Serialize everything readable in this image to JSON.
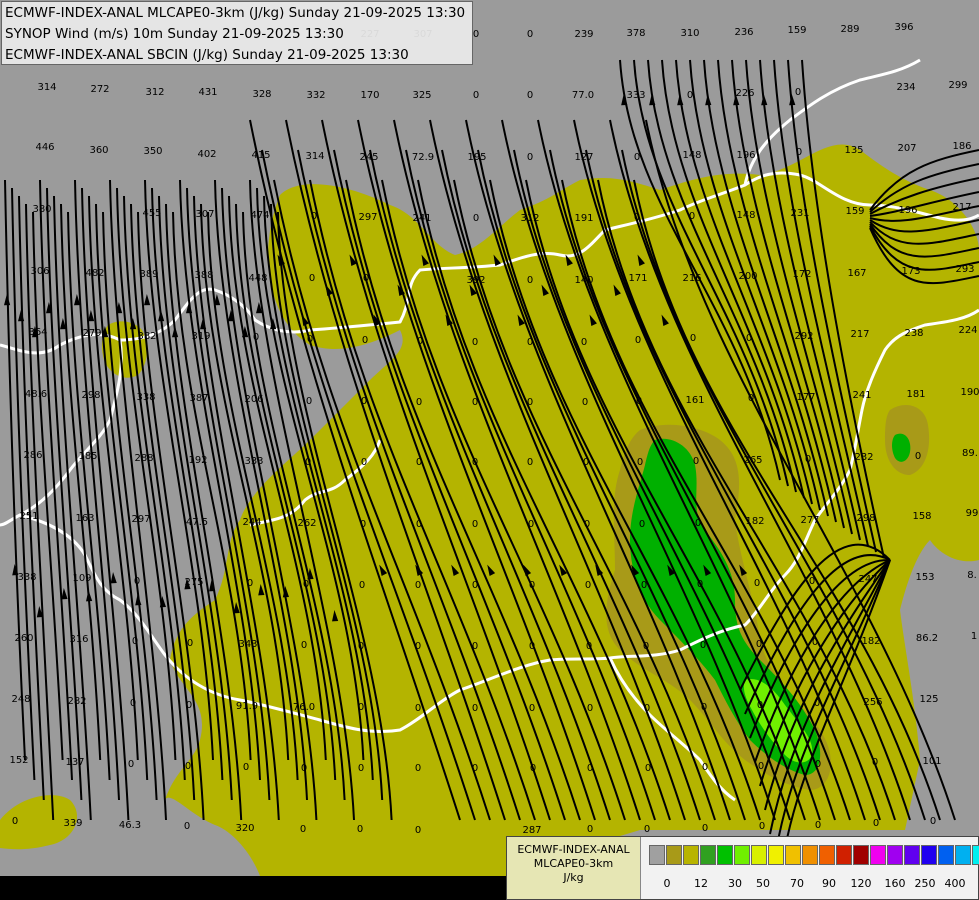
{
  "titles": [
    "ECMWF-INDEX-ANAL MLCAPE0-3km (J/kg) Sunday 21-09-2025 13:30",
    "SYNOP Wind (m/s) 10m Sunday 21-09-2025 13:30",
    "ECMWF-INDEX-ANAL SBCIN (J/kg) Sunday 21-09-2025 13:30"
  ],
  "legend": {
    "line1": "ECMWF-INDEX-ANAL",
    "line2": "MLCAPE0-3km",
    "units": "J/kg",
    "tick_labels": [
      "0",
      "12",
      "30",
      "50",
      "70",
      "90",
      "120",
      "160",
      "250",
      "400"
    ],
    "colors": [
      "#a0a0a0",
      "#a89a18",
      "#b8b400",
      "#30a020",
      "#00c000",
      "#70f000",
      "#d8f000",
      "#f0f000",
      "#f0c000",
      "#f09000",
      "#f06000",
      "#d02000",
      "#a00000",
      "#f000f0",
      "#a000f0",
      "#6000f0",
      "#2000f0",
      "#0060f0",
      "#00b0f0",
      "#00f0f0",
      "#b0f0f0",
      "#ffffff"
    ]
  },
  "map_colors": {
    "background": "#9b9b9b",
    "low_cape": "#b4b400",
    "mid_cape": "#a89a18",
    "high_cape": "#00b000",
    "very_high_cape": "#70f000",
    "borders": "#ffffff",
    "wind_lines": "#000000"
  },
  "numbers": [
    [
      "314",
      47,
      90
    ],
    [
      "272",
      100,
      92
    ],
    [
      "312",
      155,
      95
    ],
    [
      "431",
      208,
      95
    ],
    [
      "328",
      262,
      97
    ],
    [
      "332",
      316,
      98
    ],
    [
      "170",
      370,
      98
    ],
    [
      "325",
      422,
      98
    ],
    [
      "0",
      476,
      98
    ],
    [
      "0",
      530,
      98
    ],
    [
      "77.0",
      583,
      98
    ],
    [
      "333",
      636,
      98
    ],
    [
      "0",
      690,
      98
    ],
    [
      "226",
      745,
      96
    ],
    [
      "0",
      798,
      95
    ],
    [
      "234",
      906,
      90
    ],
    [
      "299",
      958,
      88
    ],
    [
      "227",
      370,
      37
    ],
    [
      "307",
      423,
      37
    ],
    [
      "0",
      476,
      37
    ],
    [
      "0",
      530,
      37
    ],
    [
      "239",
      584,
      37
    ],
    [
      "378",
      636,
      36
    ],
    [
      "310",
      690,
      36
    ],
    [
      "236",
      744,
      35
    ],
    [
      "159",
      797,
      33
    ],
    [
      "289",
      850,
      32
    ],
    [
      "396",
      904,
      30
    ],
    [
      "446",
      45,
      150
    ],
    [
      "360",
      99,
      153
    ],
    [
      "350",
      153,
      154
    ],
    [
      "402",
      207,
      157
    ],
    [
      "415",
      261,
      158
    ],
    [
      "314",
      315,
      159
    ],
    [
      "245",
      369,
      160
    ],
    [
      "72.9",
      423,
      160
    ],
    [
      "195",
      477,
      160
    ],
    [
      "0",
      530,
      160
    ],
    [
      "127",
      584,
      160
    ],
    [
      "0",
      637,
      160
    ],
    [
      "148",
      692,
      158
    ],
    [
      "196",
      746,
      158
    ],
    [
      "0",
      799,
      155
    ],
    [
      "135",
      854,
      153
    ],
    [
      "207",
      907,
      151
    ],
    [
      "186",
      962,
      149
    ],
    [
      "380",
      42,
      212
    ],
    [
      "455",
      152,
      216
    ],
    [
      "307",
      205,
      217
    ],
    [
      "474",
      260,
      218
    ],
    [
      "0",
      314,
      219
    ],
    [
      "297",
      368,
      220
    ],
    [
      "241",
      422,
      221
    ],
    [
      "0",
      476,
      221
    ],
    [
      "312",
      530,
      221
    ],
    [
      "191",
      584,
      221
    ],
    [
      "0",
      637,
      220
    ],
    [
      "0",
      692,
      219
    ],
    [
      "148",
      746,
      218
    ],
    [
      "231",
      800,
      216
    ],
    [
      "159",
      855,
      214
    ],
    [
      "196",
      908,
      213
    ],
    [
      "217",
      962,
      210
    ],
    [
      "306",
      40,
      274
    ],
    [
      "482",
      95,
      276
    ],
    [
      "389",
      149,
      277
    ],
    [
      "388",
      204,
      278
    ],
    [
      "448",
      258,
      281
    ],
    [
      "0",
      312,
      281
    ],
    [
      "0",
      366,
      281
    ],
    [
      "392",
      476,
      283
    ],
    [
      "0",
      530,
      283
    ],
    [
      "140",
      584,
      283
    ],
    [
      "171",
      638,
      281
    ],
    [
      "216",
      692,
      281
    ],
    [
      "200",
      748,
      279
    ],
    [
      "172",
      802,
      277
    ],
    [
      "167",
      857,
      276
    ],
    [
      "173",
      911,
      274
    ],
    [
      "293",
      965,
      272
    ],
    [
      "364",
      38,
      335
    ],
    [
      "279",
      92,
      336
    ],
    [
      "382",
      147,
      339
    ],
    [
      "319",
      201,
      339
    ],
    [
      "0",
      256,
      340
    ],
    [
      "0",
      310,
      342
    ],
    [
      "0",
      365,
      343
    ],
    [
      "0",
      420,
      344
    ],
    [
      "0",
      475,
      345
    ],
    [
      "0",
      530,
      345
    ],
    [
      "0",
      584,
      345
    ],
    [
      "0",
      638,
      343
    ],
    [
      "0",
      693,
      341
    ],
    [
      "0",
      749,
      341
    ],
    [
      "292",
      804,
      339
    ],
    [
      "217",
      860,
      337
    ],
    [
      "238",
      914,
      336
    ],
    [
      "224",
      968,
      333
    ],
    [
      "48.6",
      36,
      397
    ],
    [
      "298",
      91,
      398
    ],
    [
      "338",
      146,
      400
    ],
    [
      "387",
      199,
      401
    ],
    [
      "206",
      254,
      402
    ],
    [
      "0",
      309,
      404
    ],
    [
      "0",
      364,
      404
    ],
    [
      "0",
      419,
      405
    ],
    [
      "0",
      475,
      405
    ],
    [
      "0",
      530,
      405
    ],
    [
      "0",
      585,
      405
    ],
    [
      "0",
      639,
      404
    ],
    [
      "161",
      695,
      403
    ],
    [
      "0",
      751,
      401
    ],
    [
      "177",
      806,
      400
    ],
    [
      "241",
      862,
      398
    ],
    [
      "181",
      916,
      397
    ],
    [
      "190",
      970,
      395
    ],
    [
      "286",
      33,
      458
    ],
    [
      "185",
      88,
      459
    ],
    [
      "288",
      144,
      461
    ],
    [
      "192",
      198,
      463
    ],
    [
      "333",
      254,
      464
    ],
    [
      "0",
      308,
      465
    ],
    [
      "0",
      364,
      465
    ],
    [
      "0",
      419,
      465
    ],
    [
      "0",
      475,
      465
    ],
    [
      "0",
      530,
      465
    ],
    [
      "0",
      586,
      465
    ],
    [
      "0",
      640,
      465
    ],
    [
      "0",
      696,
      464
    ],
    [
      "265",
      753,
      463
    ],
    [
      "0",
      808,
      462
    ],
    [
      "232",
      864,
      460
    ],
    [
      "0",
      918,
      459
    ],
    [
      "89.",
      970,
      456
    ],
    [
      "251",
      29,
      519
    ],
    [
      "163",
      85,
      521
    ],
    [
      "297",
      141,
      522
    ],
    [
      "47.5",
      197,
      525
    ],
    [
      "244",
      252,
      525
    ],
    [
      "262",
      307,
      526
    ],
    [
      "0",
      363,
      527
    ],
    [
      "0",
      419,
      527
    ],
    [
      "0",
      475,
      527
    ],
    [
      "0",
      531,
      527
    ],
    [
      "0",
      587,
      527
    ],
    [
      "0",
      642,
      527
    ],
    [
      "0",
      698,
      526
    ],
    [
      "182",
      755,
      524
    ],
    [
      "277",
      810,
      523
    ],
    [
      "298",
      866,
      521
    ],
    [
      "158",
      922,
      519
    ],
    [
      "99",
      972,
      516
    ],
    [
      "338",
      27,
      580
    ],
    [
      "109",
      82,
      581
    ],
    [
      "0",
      137,
      584
    ],
    [
      "275",
      194,
      585
    ],
    [
      "0",
      250,
      586
    ],
    [
      "0",
      306,
      587
    ],
    [
      "0",
      362,
      588
    ],
    [
      "0",
      418,
      588
    ],
    [
      "0",
      475,
      588
    ],
    [
      "0",
      532,
      588
    ],
    [
      "0",
      588,
      588
    ],
    [
      "0",
      644,
      588
    ],
    [
      "0",
      700,
      587
    ],
    [
      "0",
      757,
      586
    ],
    [
      "0",
      812,
      584
    ],
    [
      "247",
      868,
      582
    ],
    [
      "153",
      925,
      580
    ],
    [
      "8.",
      972,
      578
    ],
    [
      "260",
      24,
      641
    ],
    [
      "316",
      79,
      642
    ],
    [
      "0",
      135,
      644
    ],
    [
      "0",
      190,
      646
    ],
    [
      "343",
      248,
      647
    ],
    [
      "0",
      304,
      648
    ],
    [
      "0",
      361,
      649
    ],
    [
      "0",
      418,
      649
    ],
    [
      "0",
      475,
      649
    ],
    [
      "0",
      532,
      649
    ],
    [
      "0",
      589,
      649
    ],
    [
      "0",
      646,
      649
    ],
    [
      "0",
      703,
      648
    ],
    [
      "0",
      759,
      647
    ],
    [
      "0",
      815,
      645
    ],
    [
      "182",
      871,
      644
    ],
    [
      "86.2",
      927,
      641
    ],
    [
      "1",
      974,
      639
    ],
    [
      "248",
      21,
      702
    ],
    [
      "282",
      77,
      704
    ],
    [
      "0",
      133,
      706
    ],
    [
      "0",
      189,
      708
    ],
    [
      "91.9",
      247,
      709
    ],
    [
      "76.0",
      304,
      710
    ],
    [
      "0",
      361,
      710
    ],
    [
      "0",
      418,
      711
    ],
    [
      "0",
      475,
      711
    ],
    [
      "0",
      532,
      711
    ],
    [
      "0",
      590,
      711
    ],
    [
      "0",
      647,
      711
    ],
    [
      "0",
      704,
      710
    ],
    [
      "0",
      760,
      708
    ],
    [
      "0",
      817,
      706
    ],
    [
      "256",
      873,
      705
    ],
    [
      "125",
      929,
      702
    ],
    [
      "152",
      19,
      763
    ],
    [
      "137",
      75,
      765
    ],
    [
      "0",
      131,
      767
    ],
    [
      "0",
      188,
      769
    ],
    [
      "0",
      246,
      770
    ],
    [
      "0",
      304,
      771
    ],
    [
      "0",
      361,
      771
    ],
    [
      "0",
      418,
      771
    ],
    [
      "0",
      475,
      771
    ],
    [
      "0",
      533,
      771
    ],
    [
      "0",
      590,
      771
    ],
    [
      "0",
      648,
      771
    ],
    [
      "0",
      705,
      770
    ],
    [
      "0",
      761,
      769
    ],
    [
      "0",
      818,
      767
    ],
    [
      "0",
      875,
      765
    ],
    [
      "101",
      932,
      764
    ],
    [
      "0",
      15,
      824
    ],
    [
      "339",
      73,
      826
    ],
    [
      "46.3",
      130,
      828
    ],
    [
      "0",
      187,
      829
    ],
    [
      "320",
      245,
      831
    ],
    [
      "0",
      303,
      832
    ],
    [
      "0",
      360,
      832
    ],
    [
      "0",
      418,
      833
    ],
    [
      "287",
      532,
      833
    ],
    [
      "0",
      590,
      832
    ],
    [
      "0",
      647,
      832
    ],
    [
      "0",
      705,
      831
    ],
    [
      "0",
      762,
      829
    ],
    [
      "0",
      818,
      828
    ],
    [
      "0",
      876,
      826
    ],
    [
      "0",
      933,
      824
    ]
  ]
}
